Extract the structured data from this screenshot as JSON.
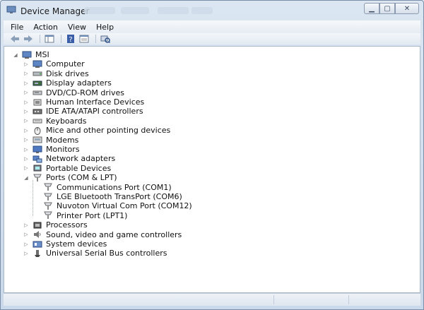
{
  "window": {
    "title": "Device Manager",
    "icon": "device-manager-icon"
  },
  "menu": [
    {
      "name": "menu-file",
      "label": "File"
    },
    {
      "name": "menu-action",
      "label": "Action"
    },
    {
      "name": "menu-view",
      "label": "View"
    },
    {
      "name": "menu-help",
      "label": "Help"
    }
  ],
  "toolbar": [
    {
      "name": "back-button",
      "icon": "arrow-left-icon"
    },
    {
      "name": "forward-button",
      "icon": "arrow-right-icon"
    },
    {
      "name": "properties-button",
      "icon": "properties-icon"
    },
    {
      "name": "help-button",
      "icon": "help-icon"
    },
    {
      "name": "show-hide-console-tree-button",
      "icon": "console-tree-icon"
    },
    {
      "name": "scan-hardware-button",
      "icon": "scan-hardware-icon"
    }
  ],
  "tree": {
    "root": {
      "label": "MSI",
      "icon": "computer-icon"
    },
    "categories": [
      {
        "label": "Computer",
        "icon": "computer-icon"
      },
      {
        "label": "Disk drives",
        "icon": "disk-drive-icon"
      },
      {
        "label": "Display adapters",
        "icon": "display-adapter-icon"
      },
      {
        "label": "DVD/CD-ROM drives",
        "icon": "dvd-drive-icon"
      },
      {
        "label": "Human Interface Devices",
        "icon": "hid-icon"
      },
      {
        "label": "IDE ATA/ATAPI controllers",
        "icon": "ide-controller-icon"
      },
      {
        "label": "Keyboards",
        "icon": "keyboard-icon"
      },
      {
        "label": "Mice and other pointing devices",
        "icon": "mouse-icon"
      },
      {
        "label": "Modems",
        "icon": "modem-icon"
      },
      {
        "label": "Monitors",
        "icon": "monitor-icon"
      },
      {
        "label": "Network adapters",
        "icon": "network-adapter-icon"
      },
      {
        "label": "Portable Devices",
        "icon": "portable-device-icon"
      },
      {
        "label": "Ports (COM & LPT)",
        "icon": "port-icon",
        "expanded": true
      },
      {
        "label": "Processors",
        "icon": "processor-icon"
      },
      {
        "label": "Sound, video and game controllers",
        "icon": "sound-icon"
      },
      {
        "label": "System devices",
        "icon": "system-device-icon"
      },
      {
        "label": "Universal Serial Bus controllers",
        "icon": "usb-icon"
      }
    ],
    "ports_children": [
      {
        "label": "Communications Port (COM1)",
        "icon": "port-icon"
      },
      {
        "label": "LGE Bluetooth TransPort (COM6)",
        "icon": "port-icon"
      },
      {
        "label": "Nuvoton Virtual Com Port (COM12)",
        "icon": "port-icon"
      },
      {
        "label": "Printer Port (LPT1)",
        "icon": "port-icon"
      }
    ]
  }
}
